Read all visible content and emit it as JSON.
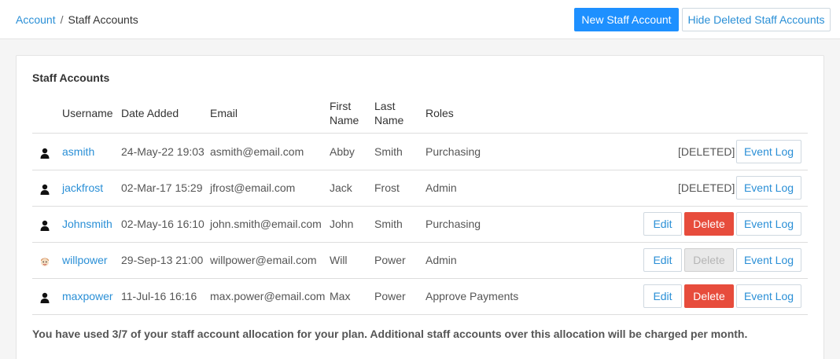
{
  "breadcrumb": {
    "parent": "Account",
    "separator": "/",
    "current": "Staff Accounts"
  },
  "toolbar": {
    "new_label": "New Staff Account",
    "hide_label": "Hide Deleted Staff Accounts"
  },
  "panel": {
    "title": "Staff Accounts"
  },
  "table": {
    "headers": {
      "username": "Username",
      "date": "Date Added",
      "email": "Email",
      "first_line1": "First",
      "first_line2": "Name",
      "last_line1": "Last",
      "last_line2": "Name",
      "roles": "Roles"
    },
    "rows": [
      {
        "avatar": "user-silhouette-icon",
        "username": "asmith",
        "date": "24-May-22 19:03",
        "email": "asmith@email.com",
        "first": "Abby",
        "last": "Smith",
        "roles": "Purchasing",
        "status": "[DELETED]",
        "edit": "",
        "delete": "",
        "log": "Event Log"
      },
      {
        "avatar": "user-silhouette-icon",
        "username": "jackfrost",
        "date": "02-Mar-17 15:29",
        "email": "jfrost@email.com",
        "first": "Jack",
        "last": "Frost",
        "roles": "Admin",
        "status": "[DELETED]",
        "edit": "",
        "delete": "",
        "log": "Event Log"
      },
      {
        "avatar": "user-silhouette-icon",
        "username": "Johnsmith",
        "date": "02-May-16 16:10",
        "email": "john.smith@email.com",
        "first": "John",
        "last": "Smith",
        "roles": "Purchasing",
        "status": "",
        "edit": "Edit",
        "delete": "Delete",
        "log": "Event Log"
      },
      {
        "avatar": "cartoon-face-icon",
        "username": "willpower",
        "date": "29-Sep-13 21:00",
        "email": "willpower@email.com",
        "first": "Will",
        "last": "Power",
        "roles": "Admin",
        "status": "",
        "edit": "Edit",
        "delete": "Delete",
        "log": "Event Log"
      },
      {
        "avatar": "user-silhouette-icon",
        "username": "maxpower",
        "date": "11-Jul-16 16:16",
        "email": "max.power@email.com",
        "first": "Max",
        "last": "Power",
        "roles": "Approve Payments",
        "status": "",
        "edit": "Edit",
        "delete": "Delete",
        "log": "Event Log"
      }
    ]
  },
  "footer": {
    "note": "You have used 3/7 of your staff account allocation for your plan. Additional staff accounts over this allocation will be charged per month."
  },
  "colors": {
    "link": "#2a8fd6",
    "primary": "#1e90ff",
    "danger": "#e74c3c",
    "disabled": "#e9e9e9"
  }
}
